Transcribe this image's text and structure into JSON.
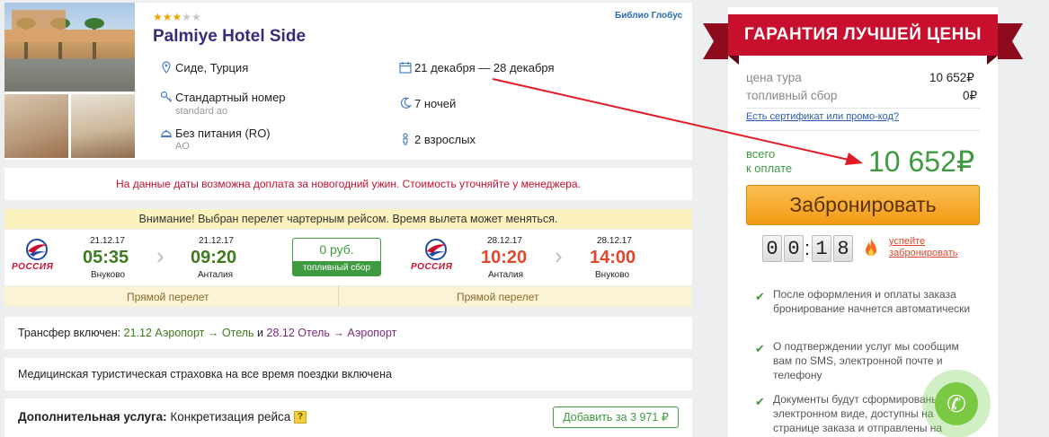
{
  "hotel": {
    "stars_on": "★★★",
    "stars_off": "★★",
    "name": "Palmiye Hotel Side",
    "operator": "Библио Глобус",
    "location": "Сиде, Турция",
    "dates": "21 декабря — 28 декабря",
    "room": "Стандартный номер",
    "room_sub": "standard ao",
    "nights": "7 ночей",
    "meal": "Без питания (RO)",
    "meal_sub": "AO",
    "guests": "2 взрослых",
    "rating_stars": 3
  },
  "notice": "На данные даты возможна доплата за новогодний ужин. Стоимость уточняйте у менеджера.",
  "charter_warning": "Внимание! Выбран перелет чартерным рейсом. Время вылета может меняться.",
  "flights": {
    "airline": "РОССИЯ",
    "out": {
      "dep_date": "21.12.17",
      "dep_time": "05:35",
      "dep_place": "Внуково",
      "arr_date": "21.12.17",
      "arr_time": "09:20",
      "arr_place": "Анталия",
      "direct": "Прямой перелет"
    },
    "back": {
      "dep_date": "28.12.17",
      "dep_time": "10:20",
      "dep_place": "Анталия",
      "arr_date": "28.12.17",
      "arr_time": "14:00",
      "arr_place": "Внуково",
      "direct": "Прямой перелет"
    },
    "fuel_value": "0 руб.",
    "fuel_label": "топливный сбор"
  },
  "transfer": {
    "label": "Трансфер включен:",
    "d1": "21.12",
    "r1a": "Аэропорт",
    "r1b": "Отель",
    "and": "и",
    "d2": "28.12",
    "r2a": "Отель",
    "r2b": "Аэропорт",
    "arrow": "→"
  },
  "insurance": "Медицинская туристическая страховка на все время поездки включена",
  "extra": {
    "label": "Дополнительная услуга:",
    "value": "Конкретизация рейса",
    "q": "?",
    "add_button": "Добавить за 3 971 ₽"
  },
  "price_panel": {
    "banner": "ГАРАНТИЯ ЛУЧШЕЙ ЦЕНЫ",
    "tour_label": "цена тура",
    "tour_value": "10 652₽",
    "fuel_label": "топливный сбор",
    "fuel_value": "0₽",
    "promo_link": "Есть сертификат или промо-код?",
    "total_label_1": "всего",
    "total_label_2": "к оплате",
    "total_value": "10 652₽",
    "book_button": "Забронировать",
    "timer": [
      "0",
      "0",
      "1",
      "8"
    ],
    "timer_sep": ":",
    "hurry_1": "успейте",
    "hurry_2": "забронировать",
    "bullets": [
      "После оформления и оплаты заказа бронирование начнется автоматически",
      "О подтверждении услуг мы сообщим вам по SMS, электронной почте и телефону",
      "Документы будут сформированы в электронном виде, доступны на странице заказа и отправлены на"
    ]
  },
  "colors": {
    "accent_green": "#3e9a3e",
    "hotel_name": "#3b2a7a",
    "banner_red": "#c8102e",
    "book_orange": "#f39a14",
    "annotation_arrow": "#e01b24"
  }
}
